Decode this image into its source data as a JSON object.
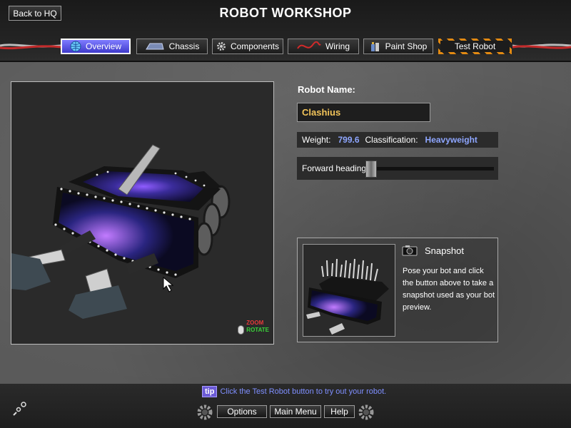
{
  "header": {
    "back_label": "Back to HQ",
    "title": "ROBOT WORKSHOP"
  },
  "tabs": [
    {
      "label": "Overview",
      "icon": "globe-icon",
      "active": true
    },
    {
      "label": "Chassis",
      "icon": "chassis-icon",
      "active": false
    },
    {
      "label": "Components",
      "icon": "gear-icon",
      "active": false
    },
    {
      "label": "Wiring",
      "icon": "wire-icon",
      "active": false
    },
    {
      "label": "Paint Shop",
      "icon": "paint-can-icon",
      "active": false
    },
    {
      "label": "Test Robot",
      "icon": "",
      "active": false
    }
  ],
  "viewport": {
    "zoom_hint": "ZOOM",
    "rotate_hint": "ROTATE"
  },
  "robot": {
    "name_label": "Robot Name:",
    "name_value": "Clashius",
    "weight_label": "Weight:",
    "weight_value": "799.6",
    "class_label": "Classification:",
    "class_value": "Heavyweight",
    "heading_label": "Forward heading:",
    "heading_value": 0.0
  },
  "snapshot": {
    "title": "Snapshot",
    "description": "Pose your bot and click the button above to take a snapshot used as your bot preview."
  },
  "footer": {
    "tip_badge": "tip",
    "tip_text": "Click the Test Robot button to try out your robot.",
    "options_label": "Options",
    "main_menu_label": "Main Menu",
    "help_label": "Help"
  },
  "colors": {
    "active_tab": "#5a55e6",
    "name_text": "#f2c45a",
    "value_text": "#8ea6ff",
    "hazard": "#e38a12"
  }
}
